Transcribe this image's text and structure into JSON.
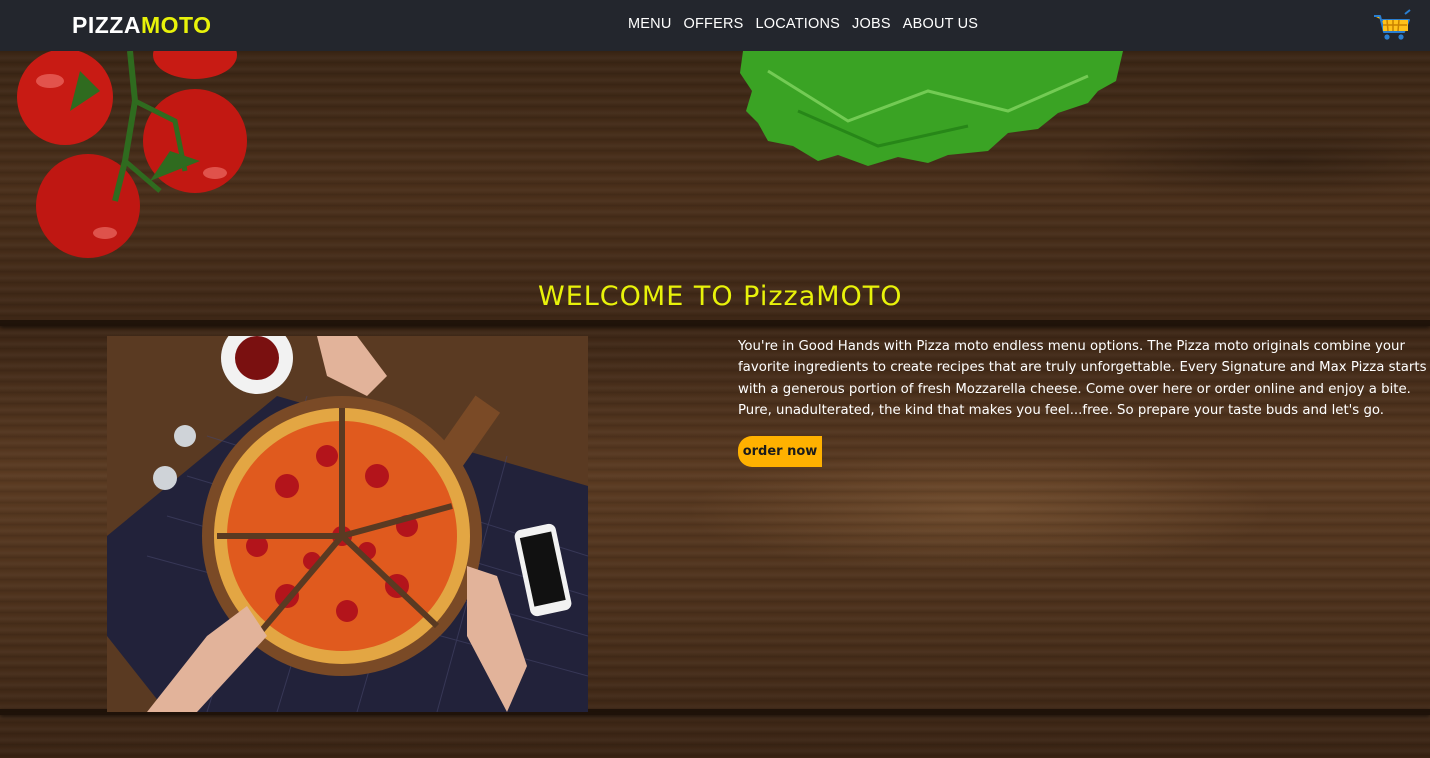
{
  "header": {
    "logo_part1": "PIZZA",
    "logo_part2": "MOTO",
    "nav": [
      "MENU",
      "OFFERS",
      "LOCATIONS",
      "JOBS",
      "ABOUT US"
    ],
    "cart_icon": "shopping-cart-icon"
  },
  "hero": {
    "heading": "WELCOME TO PizzaMOTO",
    "description": "You're in Good Hands with Pizza moto endless menu options. The Pizza moto originals combine your favorite ingredients to create recipes that are truly unforgettable. Every Signature and Max Pizza starts with a generous portion of fresh Mozzarella cheese. Come over here or order online and enjoy a bite. Pure, unadulterated, the kind that makes you feel...free. So prepare your taste buds and let's go.",
    "order_button": "order now"
  },
  "colors": {
    "header_bg": "#23262d",
    "accent_yellow": "#e8f20a",
    "button_orange": "#ffb100"
  }
}
